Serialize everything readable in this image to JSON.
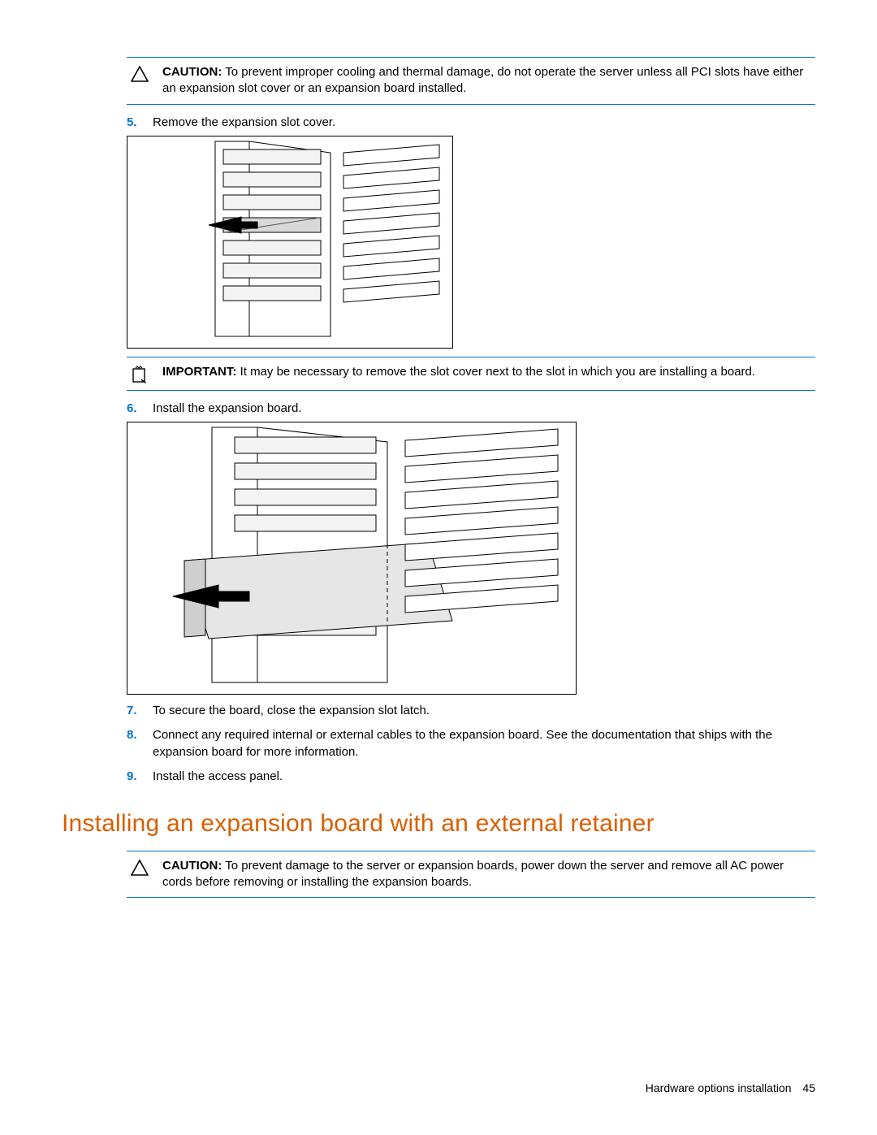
{
  "callouts": {
    "caution1": {
      "label": "CAUTION:",
      "text": "To prevent improper cooling and thermal damage, do not operate the server unless all PCI slots have either an expansion slot cover or an expansion board installed."
    },
    "important1": {
      "label": "IMPORTANT:",
      "text": "It may be necessary to remove the slot cover next to the slot in which you are installing a board."
    },
    "caution2": {
      "label": "CAUTION:",
      "text": "To prevent damage to the server or expansion boards, power down the server and remove all AC power cords before removing or installing the expansion boards."
    }
  },
  "steps": {
    "s5": {
      "num": "5.",
      "text": "Remove the expansion slot cover."
    },
    "s6": {
      "num": "6.",
      "text": "Install the expansion board."
    },
    "s7": {
      "num": "7.",
      "text": "To secure the board, close the expansion slot latch."
    },
    "s8": {
      "num": "8.",
      "text": "Connect any required internal or external cables to the expansion board. See the documentation that ships with the expansion board for more information."
    },
    "s9": {
      "num": "9.",
      "text": "Install the access panel."
    }
  },
  "heading": "Installing an expansion board with an external retainer",
  "footer": {
    "text": "Hardware options installation",
    "page": "45"
  }
}
